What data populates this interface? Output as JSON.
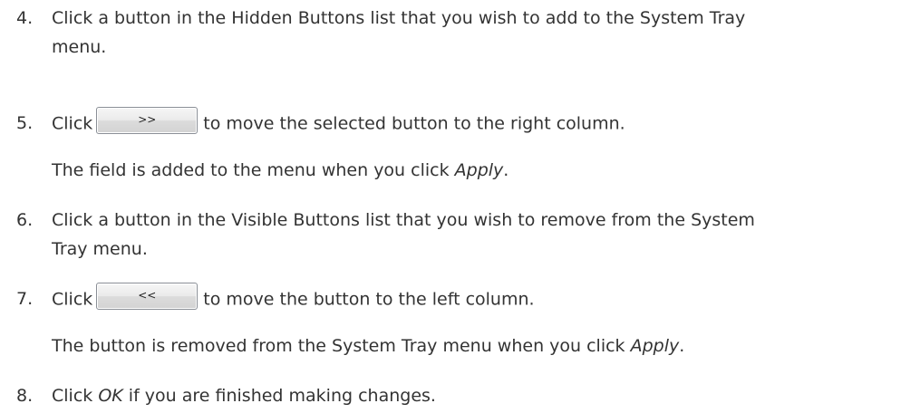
{
  "steps": [
    {
      "number": "4.",
      "text_line1": "Click a button in the Hidden Buttons list that you wish to add to the System Tray",
      "text_line2": "menu."
    },
    {
      "number": "5.",
      "before": "Click",
      "button_label": ">>",
      "after": "to move the selected button to the right column.",
      "note_before": "The field is added to the menu when you click ",
      "note_em": "Apply",
      "note_after": "."
    },
    {
      "number": "6.",
      "text_line1": "Click a button in the Visible Buttons list that you wish to remove from the System",
      "text_line2": "Tray menu."
    },
    {
      "number": "7.",
      "before": "Click",
      "button_label": "<<",
      "after": "to move the button to the left column.",
      "note_before": "The button is removed from the System Tray menu when you click ",
      "note_em": "Apply",
      "note_after": "."
    },
    {
      "number": "8.",
      "before": "Click ",
      "em": "OK",
      "after": " if you are finished making changes."
    }
  ]
}
